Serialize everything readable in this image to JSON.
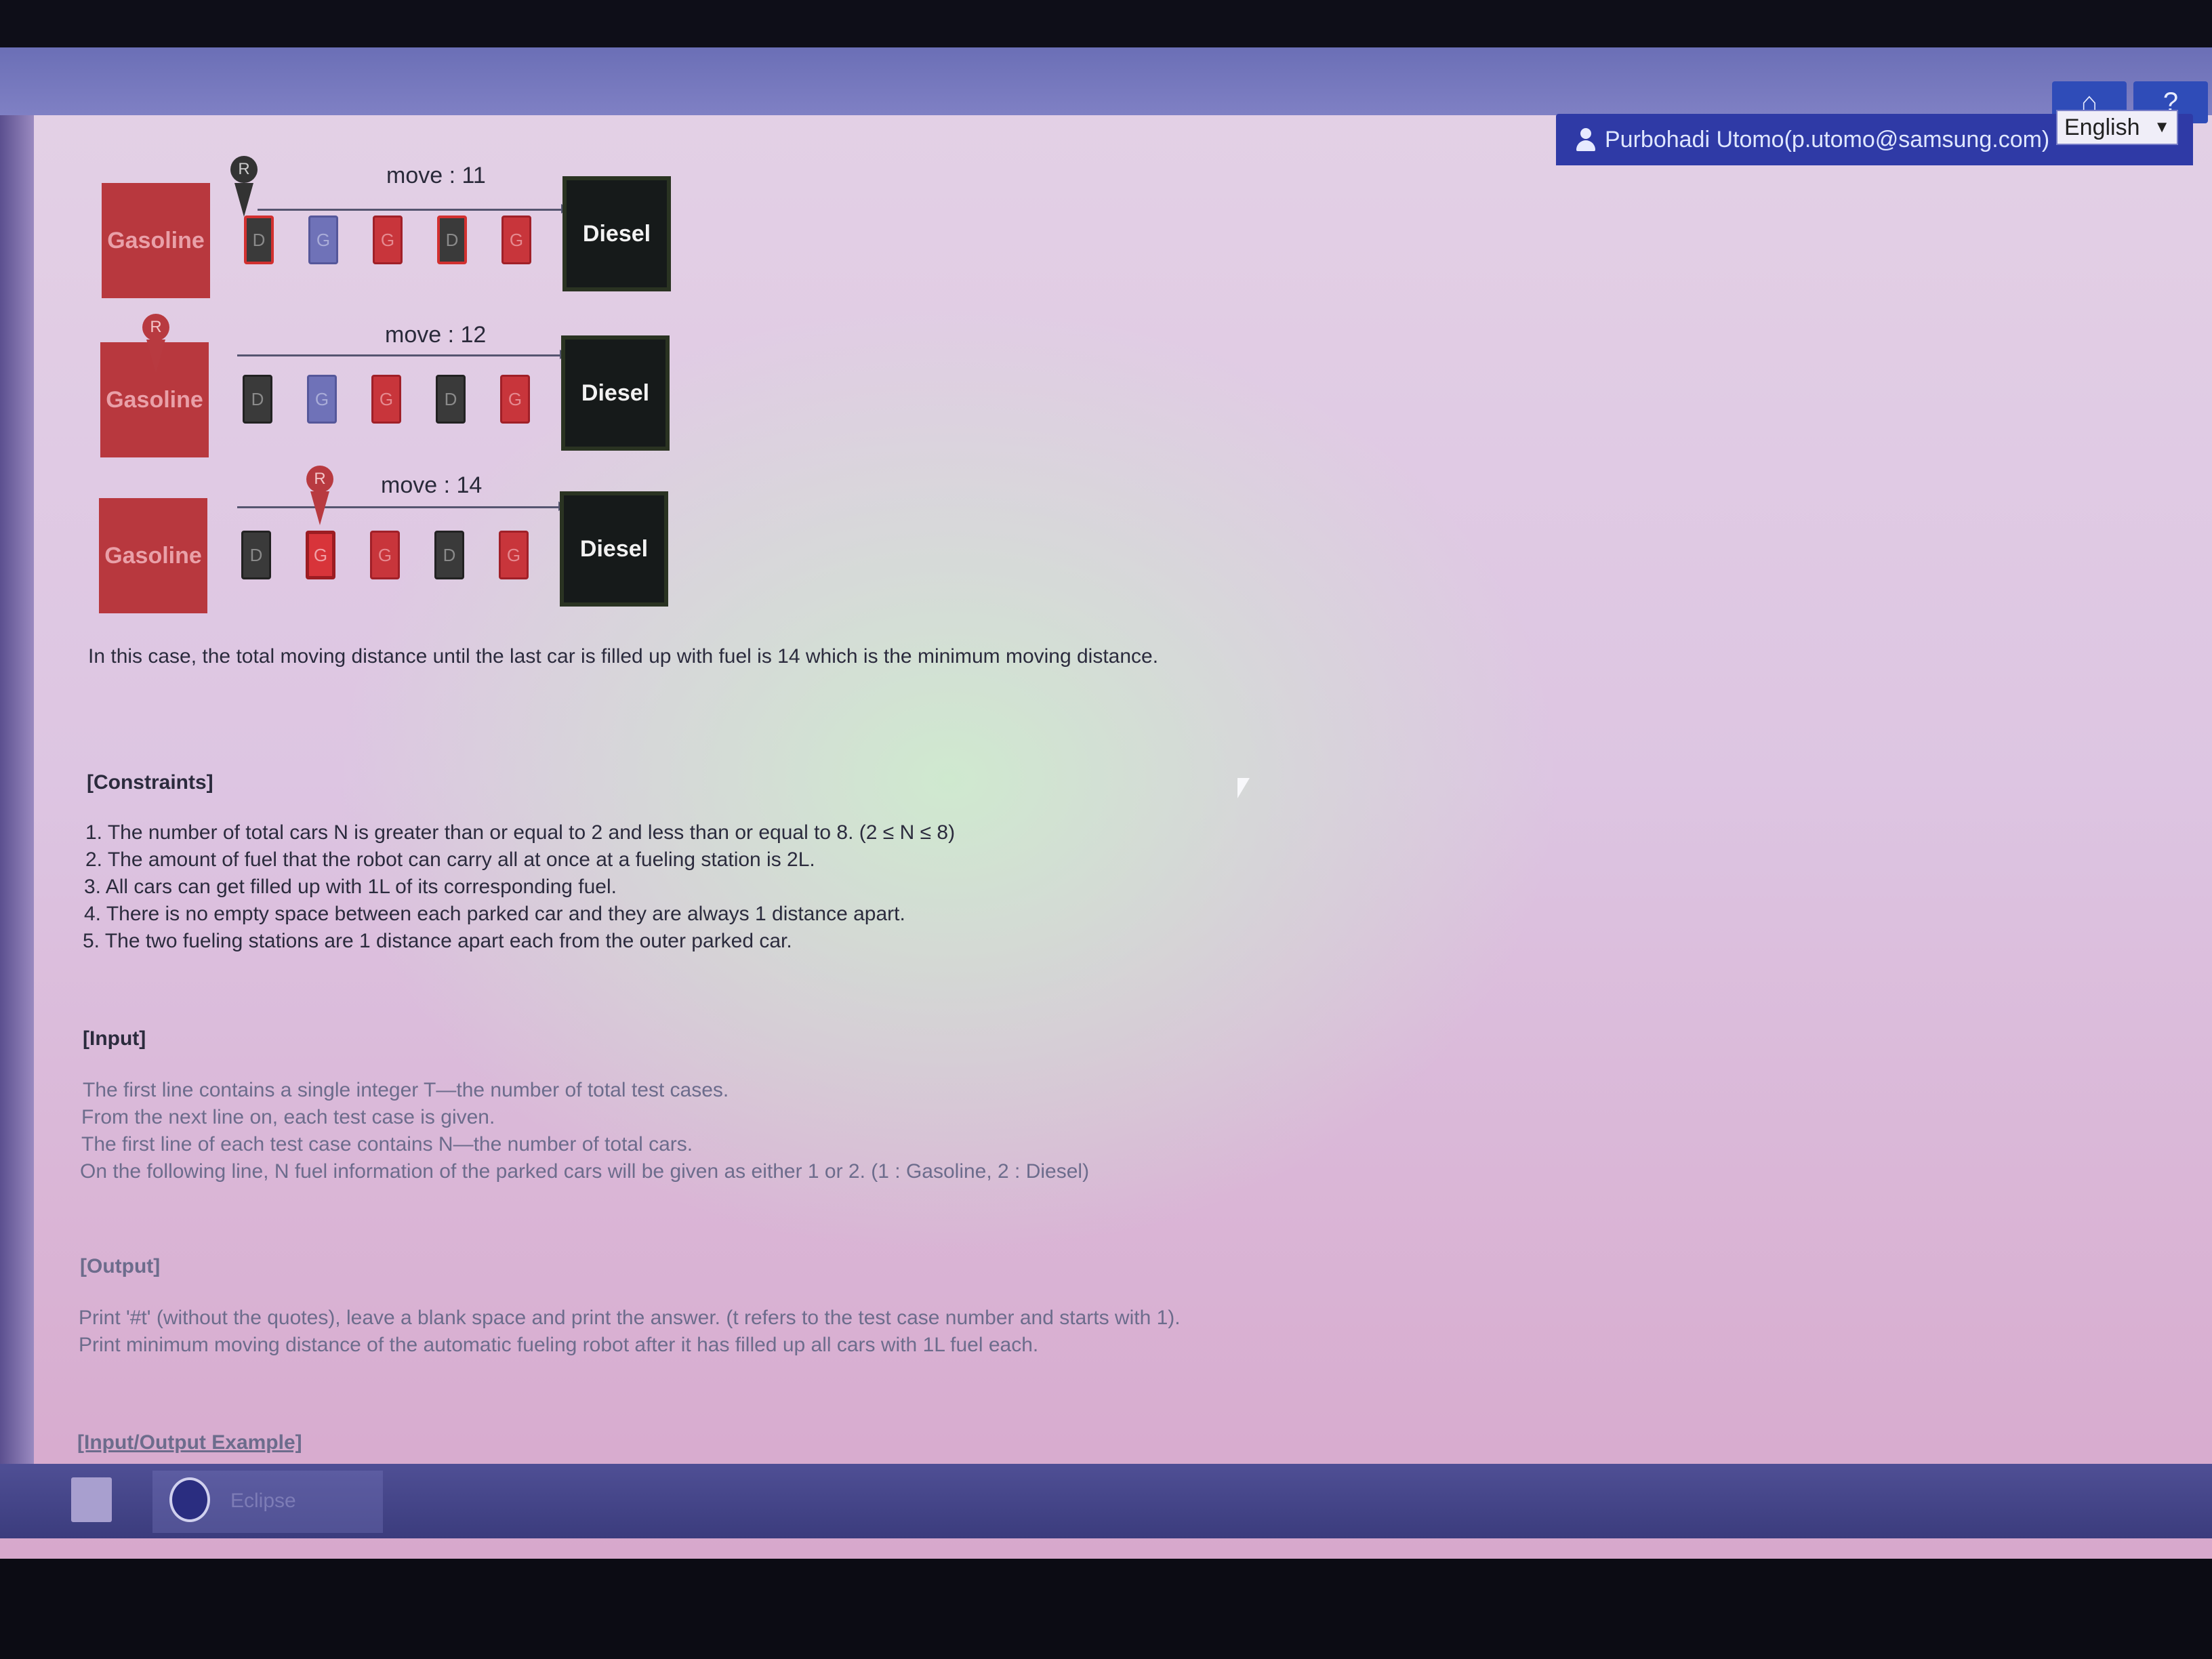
{
  "header": {
    "home_icon": "home-icon",
    "help_label": "?",
    "user_label": "Purbohadi Utomo(p.utomo@samsung.com)",
    "language": "English"
  },
  "figure": {
    "rows": [
      {
        "move_label": "move : 11",
        "station_left": "Gasoline",
        "station_right": "Diesel",
        "robot_label": "R",
        "cars": [
          "D",
          "G",
          "G",
          "D",
          "G"
        ]
      },
      {
        "move_label": "move : 12",
        "station_left": "Gasoline",
        "station_right": "Diesel",
        "robot_label": "R",
        "cars": [
          "D",
          "G",
          "G",
          "D",
          "G"
        ]
      },
      {
        "move_label": "move : 14",
        "station_left": "Gasoline",
        "station_right": "Diesel",
        "robot_label": "R",
        "cars": [
          "D",
          "G",
          "G",
          "D",
          "G"
        ]
      }
    ]
  },
  "content": {
    "summary": "In this case, the total moving distance until the last car is filled up with fuel is 14 which is the minimum moving distance.",
    "constraints_heading": "[Constraints]",
    "constraints": [
      "1. The number of total cars N is greater than or equal to 2 and less than or equal to 8. (2 ≤ N ≤ 8)",
      "2. The amount of fuel that the robot can carry all at once at a fueling station is 2L.",
      "3. All cars can get filled up with 1L of its corresponding fuel.",
      "4. There is no empty space between each parked car and they are always 1 distance apart.",
      "5. The two fueling stations are 1 distance apart each from the outer parked car."
    ],
    "input_heading": "[Input]",
    "input_lines": [
      "The first line contains a single integer T—the number of total test cases.",
      "From the next line on, each test case is given.",
      "The first line of each test case contains N—the number of total cars.",
      "On the following line, N fuel information of the parked cars will be given as either 1 or 2. (1 : Gasoline, 2 : Diesel)"
    ],
    "output_heading": "[Output]",
    "output_lines": [
      "Print '#t' (without the quotes), leave a blank space and print the answer. (t refers to the test case number and starts with 1).",
      "Print minimum moving distance of the automatic fueling robot after it has filled up all cars with 1L fuel each."
    ],
    "example_heading": "[Input/Output Example]"
  },
  "taskbar": {
    "eclipse_label": "Eclipse"
  }
}
